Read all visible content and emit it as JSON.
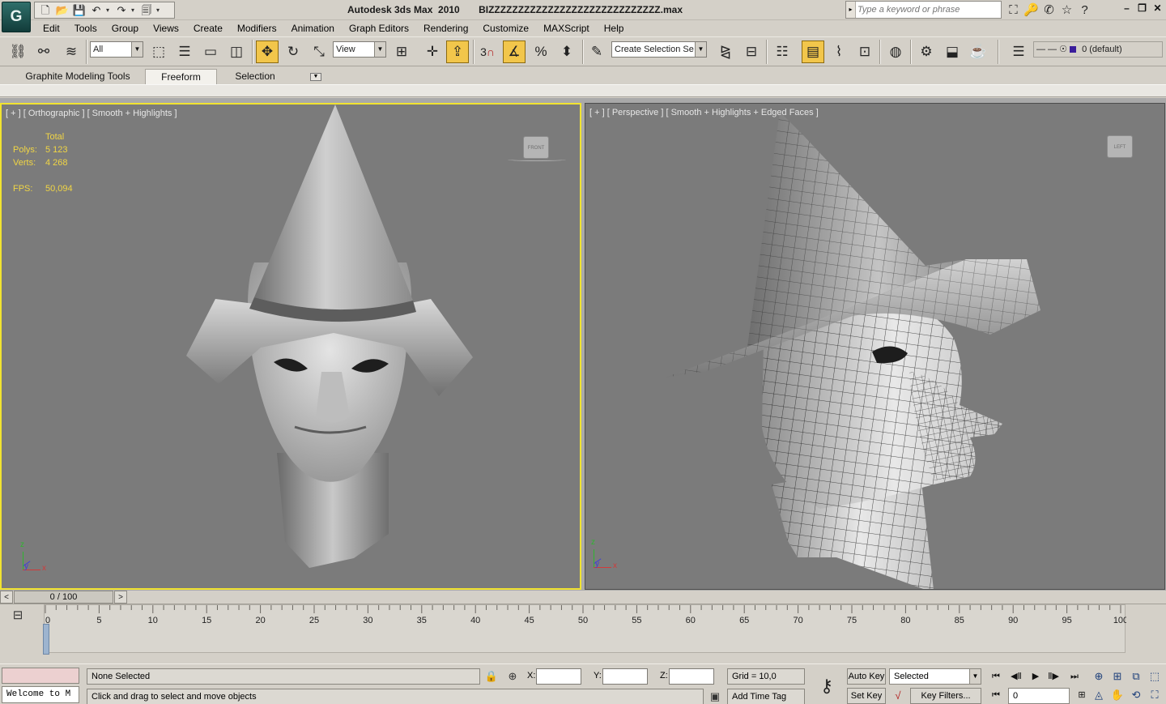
{
  "title_bar": {
    "app_logo": "G",
    "title": "Autodesk 3ds Max  2010       BIZZZZZZZZZZZZZZZZZZZZZZZZZZZZZ.max",
    "search_placeholder": "Type a keyword or phrase",
    "window_controls": [
      "–",
      "❐",
      "✕"
    ]
  },
  "quick_access": {
    "buttons": [
      {
        "name": "new-file-icon",
        "glyph": "🗋"
      },
      {
        "name": "open-file-icon",
        "glyph": "📂"
      },
      {
        "name": "save-file-icon",
        "glyph": "💾"
      },
      {
        "name": "undo-icon",
        "glyph": "↶"
      },
      {
        "name": "redo-icon",
        "glyph": "↷"
      },
      {
        "name": "project-folder-icon",
        "glyph": "🗐"
      }
    ]
  },
  "menus": [
    "Edit",
    "Tools",
    "Group",
    "Views",
    "Create",
    "Modifiers",
    "Animation",
    "Graph Editors",
    "Rendering",
    "Customize",
    "MAXScript",
    "Help"
  ],
  "toolbar": {
    "selection_filter": "All",
    "reference_coord": "View",
    "named_selection_placeholder": "Create Selection Se",
    "snap_angle_label": "3",
    "layer_name": "0 (default)"
  },
  "ribbon": {
    "tabs": [
      {
        "label": "Graphite Modeling Tools",
        "selected": false
      },
      {
        "label": "Freeform",
        "selected": true
      },
      {
        "label": "Selection",
        "selected": false
      }
    ]
  },
  "viewports": {
    "left": {
      "label": "[ + ] [ Orthographic ] [ Smooth + Highlights ]",
      "viewcube": "FRONT",
      "active": true,
      "stats": {
        "header": "Total",
        "polys_label": "Polys:",
        "polys": "5 123",
        "verts_label": "Verts:",
        "verts": "4 268",
        "fps_label": "FPS:",
        "fps": "50,094"
      },
      "axis": {
        "z": "z",
        "x": "x",
        "y": "y"
      }
    },
    "right": {
      "label": "[ + ] [ Perspective ] [ Smooth + Highlights + Edged Faces ]",
      "viewcube": "LEFT",
      "active": false,
      "axis": {
        "z": "z",
        "x": "x",
        "y": "y"
      }
    }
  },
  "time_slider": {
    "value": "0 / 100",
    "prev": "<",
    "next": ">"
  },
  "track_bar": {
    "ticks": [
      "0",
      "5",
      "10",
      "15",
      "20",
      "25",
      "30",
      "35",
      "40",
      "45",
      "50",
      "55",
      "60",
      "65",
      "70",
      "75",
      "80",
      "85",
      "90",
      "95",
      "100"
    ]
  },
  "status": {
    "listener_text": "Welcome to M",
    "selection": "None Selected",
    "prompt": "Click and drag to select and move objects",
    "x_label": "X:",
    "y_label": "Y:",
    "z_label": "Z:",
    "grid": "Grid = 10,0",
    "add_time_tag": "Add Time Tag",
    "auto_key": "Auto Key",
    "set_key": "Set Key",
    "key_mode": "Selected",
    "key_filters": "Key Filters...",
    "current_frame": "0"
  },
  "colors": {
    "ui_gray": "#d4d0c8",
    "viewport_bg": "#7b7b7b",
    "active_border": "#f1e330",
    "stats_text": "#f0d545",
    "active_tool": "#f2c64b"
  }
}
